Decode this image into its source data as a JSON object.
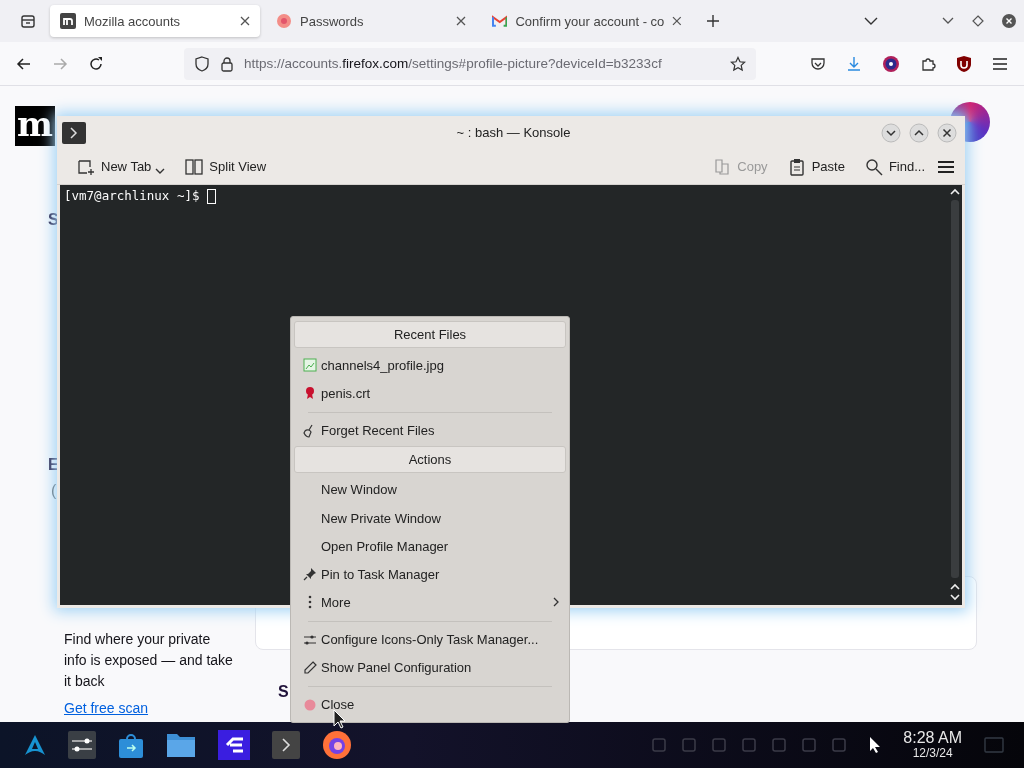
{
  "browser": {
    "tabs": [
      {
        "title": "Mozilla accounts",
        "selected": true
      },
      {
        "title": "Passwords",
        "selected": false
      },
      {
        "title": "Confirm your account - co",
        "selected": false
      }
    ],
    "url": {
      "scheme": "https://accounts.",
      "domain": "firefox.com",
      "path": "/settings#profile-picture?deviceId=b3233cf"
    }
  },
  "page": {
    "logo": "m",
    "fragments": [
      "S",
      "E",
      "("
    ],
    "monitor_text": "Find where your private info is exposed — and take it back",
    "monitor_link": "Get free scan",
    "section_fragment": "S"
  },
  "konsole": {
    "title": "~ : bash — Konsole",
    "toolbar": [
      {
        "label": "New Tab",
        "disabled": false
      },
      {
        "label": "Split View",
        "disabled": false
      },
      {
        "label": "Copy",
        "disabled": true
      },
      {
        "label": "Paste",
        "disabled": false
      },
      {
        "label": "Find...",
        "disabled": false
      }
    ],
    "prompt": "[vm7@archlinux ~]$"
  },
  "menu": [
    {
      "kind": "header",
      "label": "Recent Files"
    },
    {
      "kind": "item",
      "label": "channels4_profile.jpg"
    },
    {
      "kind": "item",
      "label": "penis.crt"
    },
    {
      "kind": "separator"
    },
    {
      "kind": "item",
      "label": "Forget Recent Files"
    },
    {
      "kind": "header",
      "label": "Actions"
    },
    {
      "kind": "item",
      "label": "New Window"
    },
    {
      "kind": "item",
      "label": "New Private Window"
    },
    {
      "kind": "item",
      "label": "Open Profile Manager"
    },
    {
      "kind": "item",
      "label": "Pin to Task Manager"
    },
    {
      "kind": "submenu",
      "label": "More"
    },
    {
      "kind": "separator"
    },
    {
      "kind": "item",
      "label": "Configure Icons-Only Task Manager..."
    },
    {
      "kind": "item",
      "label": "Show Panel Configuration"
    },
    {
      "kind": "separator"
    },
    {
      "kind": "item",
      "label": "Close"
    }
  ],
  "taskbar": {
    "time": "8:28 AM",
    "date": "12/3/24"
  }
}
